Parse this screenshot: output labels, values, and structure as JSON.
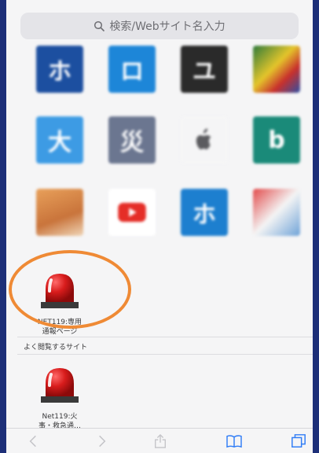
{
  "search": {
    "placeholder": "検索/Webサイト名入力"
  },
  "favorites": [
    {
      "glyph": "ホ",
      "caption": ""
    },
    {
      "glyph": "ロ",
      "caption": ""
    },
    {
      "glyph": "ユ",
      "caption": ""
    },
    {
      "glyph": "",
      "caption": ""
    },
    {
      "glyph": "大",
      "caption": ""
    },
    {
      "glyph": "災",
      "caption": ""
    },
    {
      "glyph": "",
      "caption": ""
    },
    {
      "glyph": "b",
      "caption": ""
    },
    {
      "glyph": "",
      "caption": ""
    },
    {
      "glyph": "",
      "caption": ""
    },
    {
      "glyph": "ホ",
      "caption": ""
    },
    {
      "glyph": "",
      "caption": ""
    },
    {
      "caption": "NET119:専用\n通報ページ"
    }
  ],
  "frequent": {
    "label": "よく閲覧するサイト",
    "items": [
      {
        "caption": "Net119:火\n事・救急通…"
      }
    ]
  },
  "colors": {
    "highlight": "#ef8a35",
    "siren_red": "#d81c1c"
  }
}
